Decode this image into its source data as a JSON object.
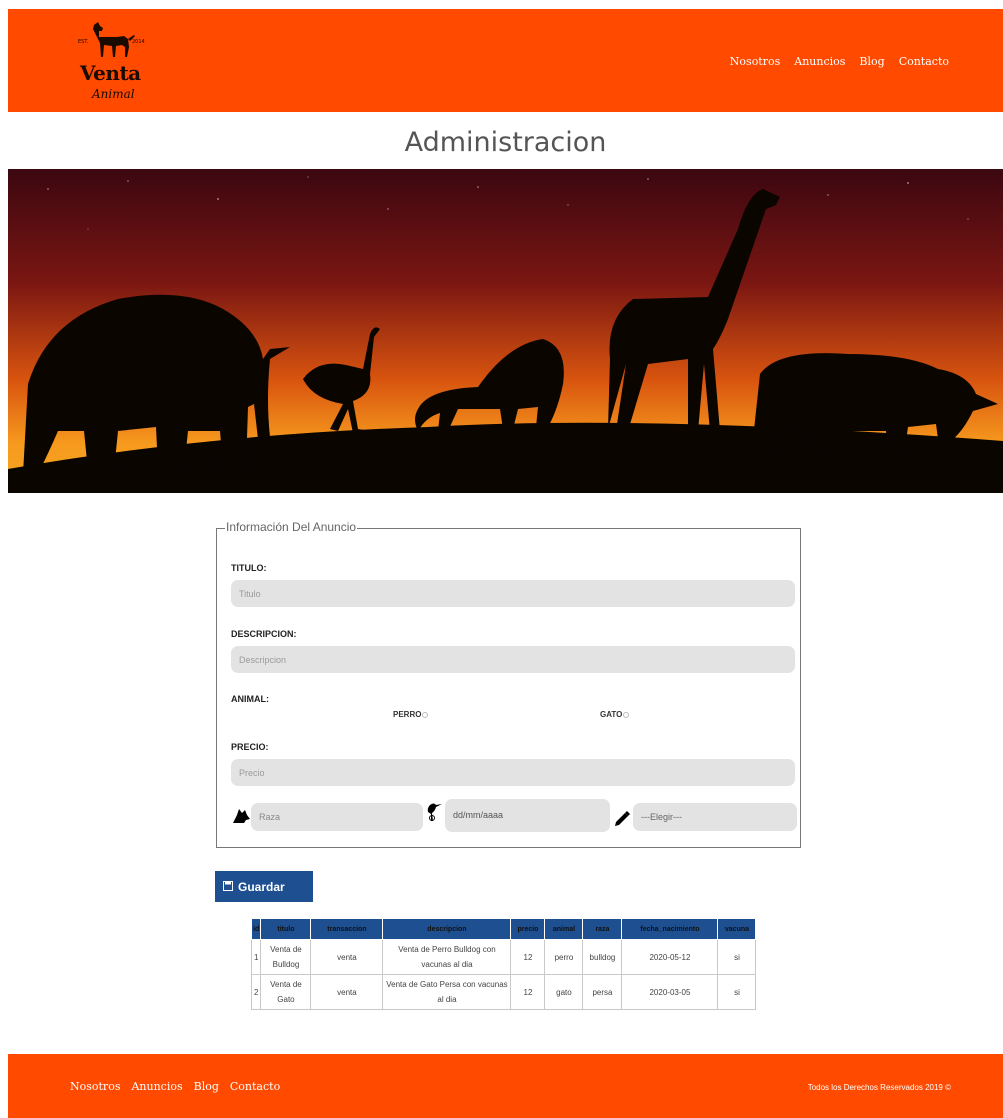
{
  "header": {
    "logo": {
      "brand": "Venta",
      "subtitle": "Animal",
      "left_text": "EST.",
      "right_text": "2014"
    },
    "nav": [
      "Nosotros",
      "Anuncios",
      "Blog",
      "Contacto"
    ]
  },
  "page_title": "Administracion",
  "form": {
    "legend": "Información Del Anuncio",
    "titulo": {
      "label": "TITULO:",
      "placeholder": "Titulo"
    },
    "descripcion": {
      "label": "DESCRIPCION:",
      "placeholder": "Descripcion"
    },
    "animal": {
      "label": "ANIMAL:",
      "options": [
        "PERRO",
        "GATO"
      ]
    },
    "precio": {
      "label": "PRECIO:",
      "placeholder": "Precio"
    },
    "raza": {
      "placeholder": "Raza",
      "icon": "dog-head-icon"
    },
    "fecha": {
      "placeholder": "dd/mm/aaaa",
      "icon": "stork-icon"
    },
    "vacuna": {
      "placeholder": "---Elegir---",
      "icon": "pencil-icon"
    }
  },
  "save_button": {
    "label": "Guardar",
    "icon": "floppy-disk-icon"
  },
  "table": {
    "headers": [
      "id",
      "titulo",
      "transaccion",
      "descripcion",
      "precio",
      "animal",
      "raza",
      "fecha_nacimiento",
      "vacuna"
    ],
    "rows": [
      [
        "1",
        "Venta de Bulldog",
        "venta",
        "Venta de Perro Bulldog con vacunas al dia",
        "12",
        "perro",
        "bulldog",
        "2020-05-12",
        "si"
      ],
      [
        "2",
        "Venta de Gato",
        "venta",
        "Venta de Gato Persa con vacunas al dia",
        "12",
        "gato",
        "persa",
        "2020-03-05",
        "si"
      ]
    ]
  },
  "footer": {
    "nav": [
      "Nosotros",
      "Anuncios",
      "Blog",
      "Contacto"
    ],
    "copyright": "Todos los Derechos Reservados 2019 ©"
  },
  "colors": {
    "brand_orange": "#ff4a00",
    "button_blue": "#1d4f91",
    "input_gray": "#e3e3e3"
  }
}
